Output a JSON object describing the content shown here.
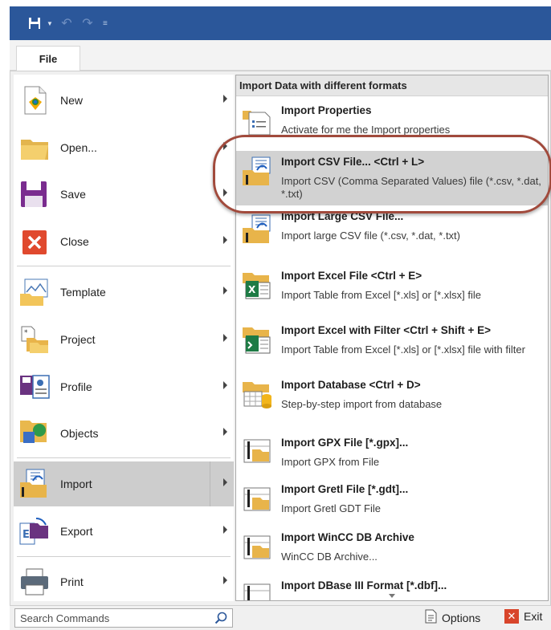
{
  "quick_access": {
    "save_icon": "save-icon",
    "undo_icon": "undo-icon",
    "redo_icon": "redo-icon"
  },
  "tabs": {
    "file_label": "File"
  },
  "left_menu": {
    "items": [
      {
        "label": "New",
        "accel": "N",
        "icon": "new-document-icon"
      },
      {
        "label": "Open...",
        "accel": "O",
        "icon": "folder-open-icon"
      },
      {
        "label": "Save",
        "accel": "S",
        "icon": "save-icon"
      },
      {
        "label": "Close",
        "accel": "C",
        "icon": "close-icon"
      },
      {
        "label": "Template",
        "accel": "T",
        "icon": "template-icon"
      },
      {
        "label": "Project",
        "accel": "r",
        "icon": "project-icon"
      },
      {
        "label": "Profile",
        "accel": "f",
        "icon": "profile-icon"
      },
      {
        "label": "Objects",
        "accel": "j",
        "icon": "objects-icon"
      },
      {
        "label": "Import",
        "accel": "I",
        "icon": "import-icon"
      },
      {
        "label": "Export",
        "accel": "E",
        "icon": "export-icon"
      },
      {
        "label": "Print",
        "accel": "P",
        "icon": "print-icon"
      }
    ],
    "selected": "Import"
  },
  "right_panel": {
    "header": "Import Data with different formats",
    "items": [
      {
        "title": "Import Properties",
        "desc": "Activate for me the Import properties"
      },
      {
        "title": "Import CSV File... <Ctrl + L>",
        "desc": "Import CSV (Comma Separated Values) file (*.csv, *.dat, *.txt)"
      },
      {
        "title": "Import Large CSV File...",
        "desc": "Import large CSV file (*.csv, *.dat, *.txt)"
      },
      {
        "title": "Import Excel File <Ctrl + E>",
        "desc": "Import Table from Excel [*.xls] or [*.xlsx] file"
      },
      {
        "title": "Import Excel with Filter <Ctrl + Shift + E>",
        "desc": "Import Table from Excel [*.xls] or [*.xlsx] file with filter"
      },
      {
        "title": "Import Database <Ctrl + D>",
        "desc": "Step-by-step import from database"
      },
      {
        "title": "Import GPX File [*.gpx]...",
        "desc": "Import GPX from File"
      },
      {
        "title": "Import Gretl File [*.gdt]...",
        "desc": "Import Gretl GDT File"
      },
      {
        "title": "Import WinCC DB Archive",
        "desc": "WinCC DB Archive..."
      },
      {
        "title": "Import DBase III Format [*.dbf]...",
        "desc": ""
      }
    ]
  },
  "bottom": {
    "search_placeholder": "Search Commands",
    "options_label": "Options",
    "exit_label": "Exit"
  },
  "colors": {
    "titlebar": "#2b579a",
    "highlight_ring": "#a14a3c",
    "close_red": "#d8452b"
  }
}
